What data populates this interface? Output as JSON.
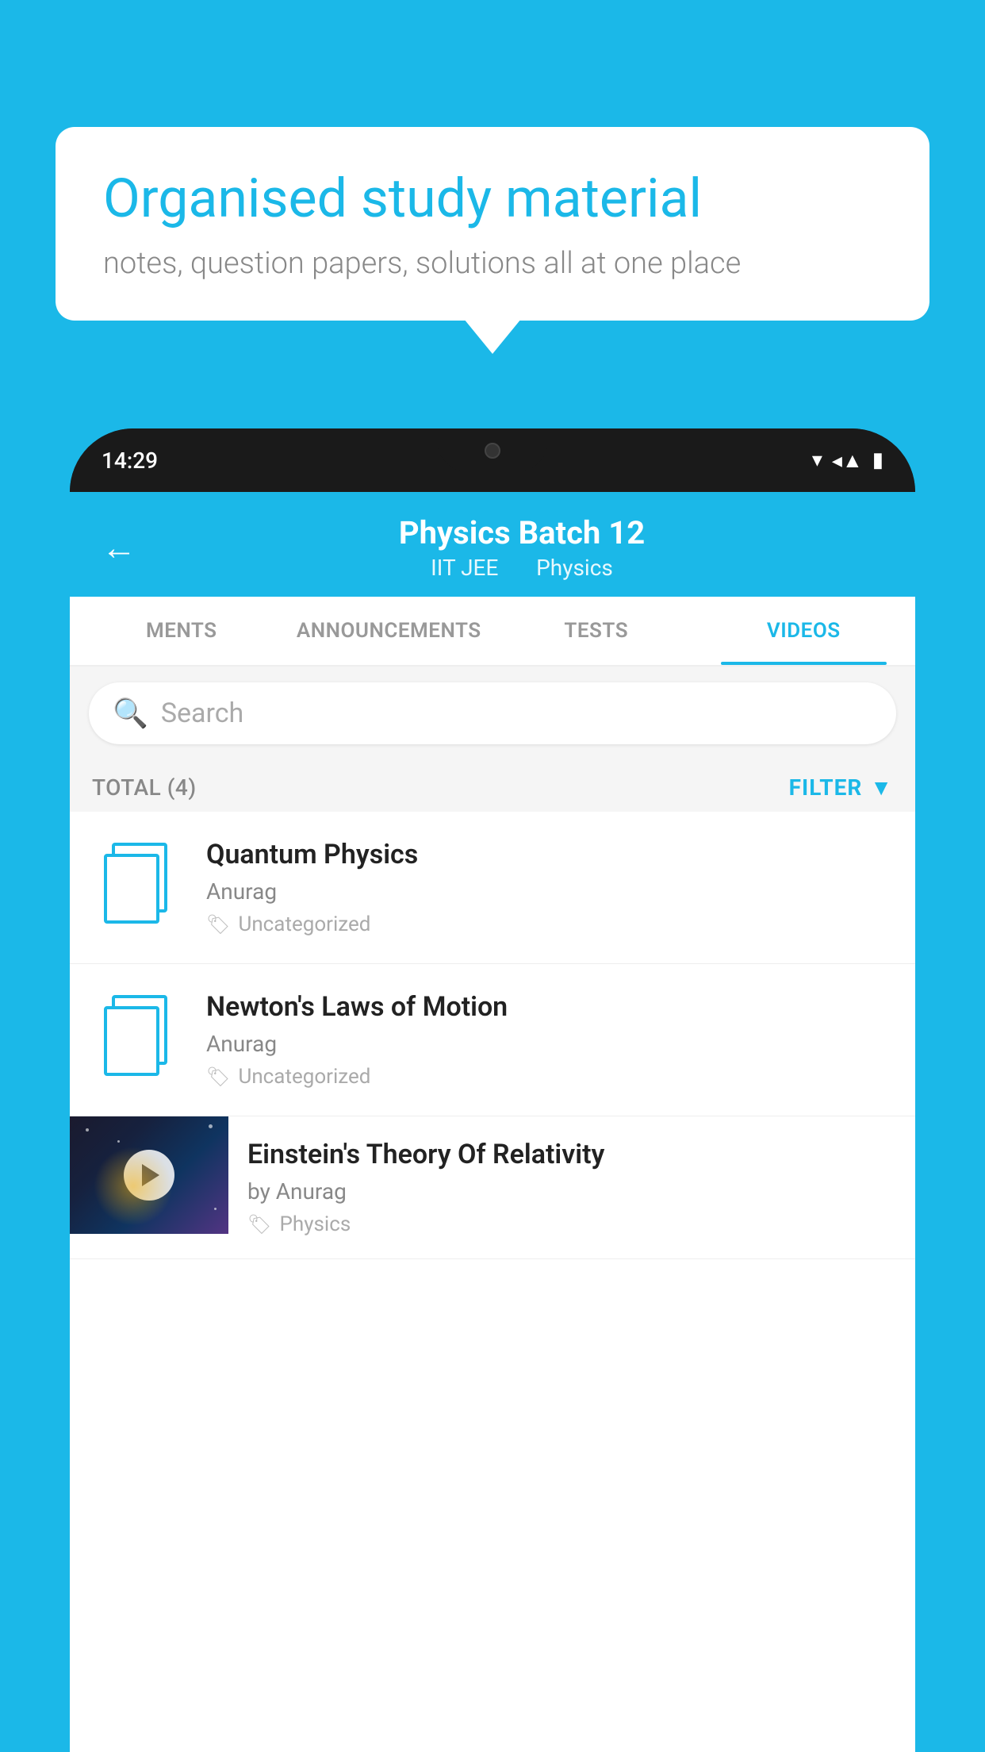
{
  "background_color": "#1BB8E8",
  "speech_bubble": {
    "title": "Organised study material",
    "subtitle": "notes, question papers, solutions all at one place"
  },
  "phone": {
    "time": "14:29",
    "app_header": {
      "title": "Physics Batch 12",
      "subtitle_left": "IIT JEE",
      "subtitle_right": "Physics"
    },
    "tabs": [
      {
        "label": "MENTS",
        "active": false
      },
      {
        "label": "ANNOUNCEMENTS",
        "active": false
      },
      {
        "label": "TESTS",
        "active": false
      },
      {
        "label": "VIDEOS",
        "active": true
      }
    ],
    "search": {
      "placeholder": "Search"
    },
    "filter": {
      "total_label": "TOTAL (4)",
      "filter_label": "FILTER"
    },
    "videos": [
      {
        "title": "Quantum Physics",
        "author": "Anurag",
        "tag": "Uncategorized",
        "has_thumbnail": false
      },
      {
        "title": "Newton's Laws of Motion",
        "author": "Anurag",
        "tag": "Uncategorized",
        "has_thumbnail": false
      },
      {
        "title": "Einstein's Theory Of Relativity",
        "author": "by Anurag",
        "tag": "Physics",
        "has_thumbnail": true
      }
    ]
  }
}
